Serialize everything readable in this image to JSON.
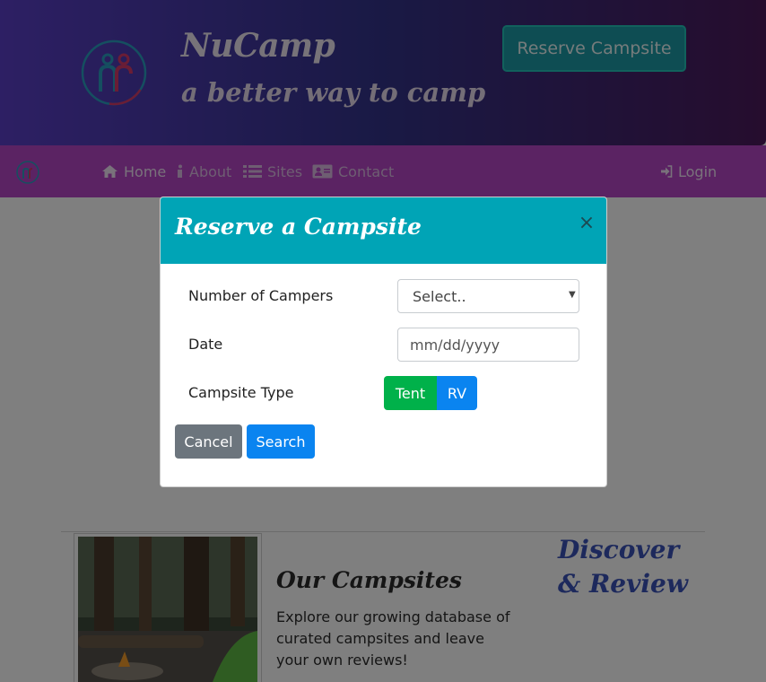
{
  "header": {
    "brand_title": "NuCamp",
    "brand_subtitle": "a better way to camp",
    "reserve_button": "Reserve Campsite"
  },
  "nav": {
    "items": [
      {
        "label": "Home",
        "icon": "home-icon"
      },
      {
        "label": "About",
        "icon": "info-icon"
      },
      {
        "label": "Sites",
        "icon": "list-icon"
      },
      {
        "label": "Contact",
        "icon": "address-card-icon"
      }
    ],
    "login": {
      "label": "Login",
      "icon": "sign-in-icon"
    }
  },
  "modal": {
    "title": "Reserve a Campsite",
    "close": "×",
    "campers_label": "Number of Campers",
    "campers_select": "Select..",
    "date_label": "Date",
    "date_placeholder": "mm/dd/yyyy",
    "type_label": "Campsite Type",
    "tent": "Tent",
    "rv": "RV",
    "cancel": "Cancel",
    "search": "Search"
  },
  "content": {
    "section_title": "Our Campsites",
    "section_text": "Explore our growing database of curated campsites and leave your own reviews!",
    "aside_title": "Discover & Review"
  },
  "colors": {
    "header_gradient": [
      "#5b3fc8",
      "#33338a",
      "#4c1a5c"
    ],
    "navbar": "#b646c6",
    "modal_header": "#00a4b6",
    "tent_button": "#00b14a",
    "primary_button": "#0a84f0",
    "cancel_button": "#6c757d"
  }
}
